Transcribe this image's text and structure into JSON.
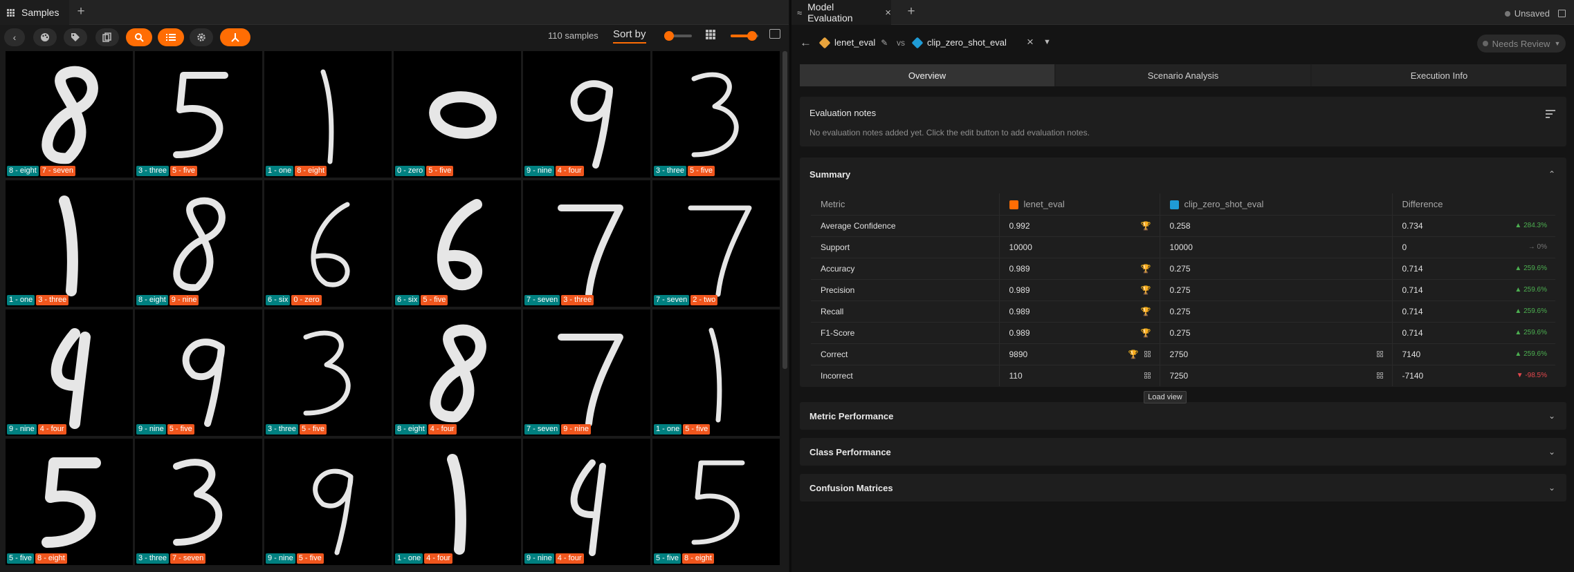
{
  "left_panel": {
    "tab_label": "Samples",
    "sample_count": "110 samples",
    "sort_label": "Sort by",
    "toolbar_icons": [
      "back-icon",
      "color-palette-icon",
      "tag-icon",
      "copy-icon",
      "search-icon",
      "list-icon",
      "settings-icon",
      "pin-icon"
    ],
    "samples": [
      {
        "gt": "8 - eight",
        "pred": "7 - seven",
        "digit": "8"
      },
      {
        "gt": "3 - three",
        "pred": "5 - five",
        "digit": "5"
      },
      {
        "gt": "1 - one",
        "pred": "8 - eight",
        "digit": "1"
      },
      {
        "gt": "0 - zero",
        "pred": "5 - five",
        "digit": "0"
      },
      {
        "gt": "9 - nine",
        "pred": "4 - four",
        "digit": "9"
      },
      {
        "gt": "3 - three",
        "pred": "5 - five",
        "digit": "3"
      },
      {
        "gt": "1 - one",
        "pred": "3 - three",
        "digit": "1"
      },
      {
        "gt": "8 - eight",
        "pred": "9 - nine",
        "digit": "8"
      },
      {
        "gt": "6 - six",
        "pred": "0 - zero",
        "digit": "6"
      },
      {
        "gt": "6 - six",
        "pred": "5 - five",
        "digit": "6"
      },
      {
        "gt": "7 - seven",
        "pred": "3 - three",
        "digit": "7"
      },
      {
        "gt": "7 - seven",
        "pred": "2 - two",
        "digit": "7"
      },
      {
        "gt": "9 - nine",
        "pred": "4 - four",
        "digit": "4"
      },
      {
        "gt": "9 - nine",
        "pred": "5 - five",
        "digit": "9"
      },
      {
        "gt": "3 - three",
        "pred": "5 - five",
        "digit": "3"
      },
      {
        "gt": "8 - eight",
        "pred": "4 - four",
        "digit": "8"
      },
      {
        "gt": "7 - seven",
        "pred": "9 - nine",
        "digit": "7"
      },
      {
        "gt": "1 - one",
        "pred": "5 - five",
        "digit": "1"
      },
      {
        "gt": "5 - five",
        "pred": "8 - eight",
        "digit": "5"
      },
      {
        "gt": "3 - three",
        "pred": "7 - seven",
        "digit": "3"
      },
      {
        "gt": "9 - nine",
        "pred": "5 - five",
        "digit": "9"
      },
      {
        "gt": "1 - one",
        "pred": "4 - four",
        "digit": "1"
      },
      {
        "gt": "9 - nine",
        "pred": "4 - four",
        "digit": "4"
      },
      {
        "gt": "5 - five",
        "pred": "8 - eight",
        "digit": "5"
      }
    ]
  },
  "right_panel": {
    "tab_label": "Model Evaluation",
    "unsaved_label": "Unsaved",
    "eval_a": "lenet_eval",
    "vs_label": "vs",
    "eval_b": "clip_zero_shot_eval",
    "review_label": "Needs Review",
    "tabs": [
      "Overview",
      "Scenario Analysis",
      "Execution Info"
    ],
    "notes": {
      "title": "Evaluation notes",
      "text": "No evaluation notes added yet. Click the edit button to add evaluation notes."
    },
    "summary": {
      "title": "Summary",
      "headers": [
        "Metric",
        "lenet_eval",
        "clip_zero_shot_eval",
        "Difference"
      ],
      "rows": [
        {
          "metric": "Average Confidence",
          "a": "0.992",
          "b": "0.258",
          "diff": "0.734",
          "delta": "284.3%",
          "dir": "up",
          "winner": true,
          "load": false
        },
        {
          "metric": "Support",
          "a": "10000",
          "b": "10000",
          "diff": "0",
          "delta": "0%",
          "dir": "flat",
          "winner": false,
          "load": false
        },
        {
          "metric": "Accuracy",
          "a": "0.989",
          "b": "0.275",
          "diff": "0.714",
          "delta": "259.6%",
          "dir": "up",
          "winner": true,
          "load": false
        },
        {
          "metric": "Precision",
          "a": "0.989",
          "b": "0.275",
          "diff": "0.714",
          "delta": "259.6%",
          "dir": "up",
          "winner": true,
          "load": false
        },
        {
          "metric": "Recall",
          "a": "0.989",
          "b": "0.275",
          "diff": "0.714",
          "delta": "259.6%",
          "dir": "up",
          "winner": true,
          "load": false
        },
        {
          "metric": "F1-Score",
          "a": "0.989",
          "b": "0.275",
          "diff": "0.714",
          "delta": "259.6%",
          "dir": "up",
          "winner": true,
          "load": false
        },
        {
          "metric": "Correct",
          "a": "9890",
          "b": "2750",
          "diff": "7140",
          "delta": "259.6%",
          "dir": "up",
          "winner": true,
          "load": true
        },
        {
          "metric": "Incorrect",
          "a": "110",
          "b": "7250",
          "diff": "-7140",
          "delta": "-98.5%",
          "dir": "down",
          "winner": false,
          "load": true
        }
      ]
    },
    "tooltip": "Load view",
    "sections": [
      "Metric Performance",
      "Class Performance",
      "Confusion Matrices"
    ]
  },
  "colors": {
    "accent": "#ff6d04",
    "gt_tag": "#008080",
    "pred_tag": "#f0561d",
    "eval_a": "#ff6d04",
    "eval_b": "#1f9bd6",
    "up": "#4caf50",
    "down": "#e5484d"
  }
}
